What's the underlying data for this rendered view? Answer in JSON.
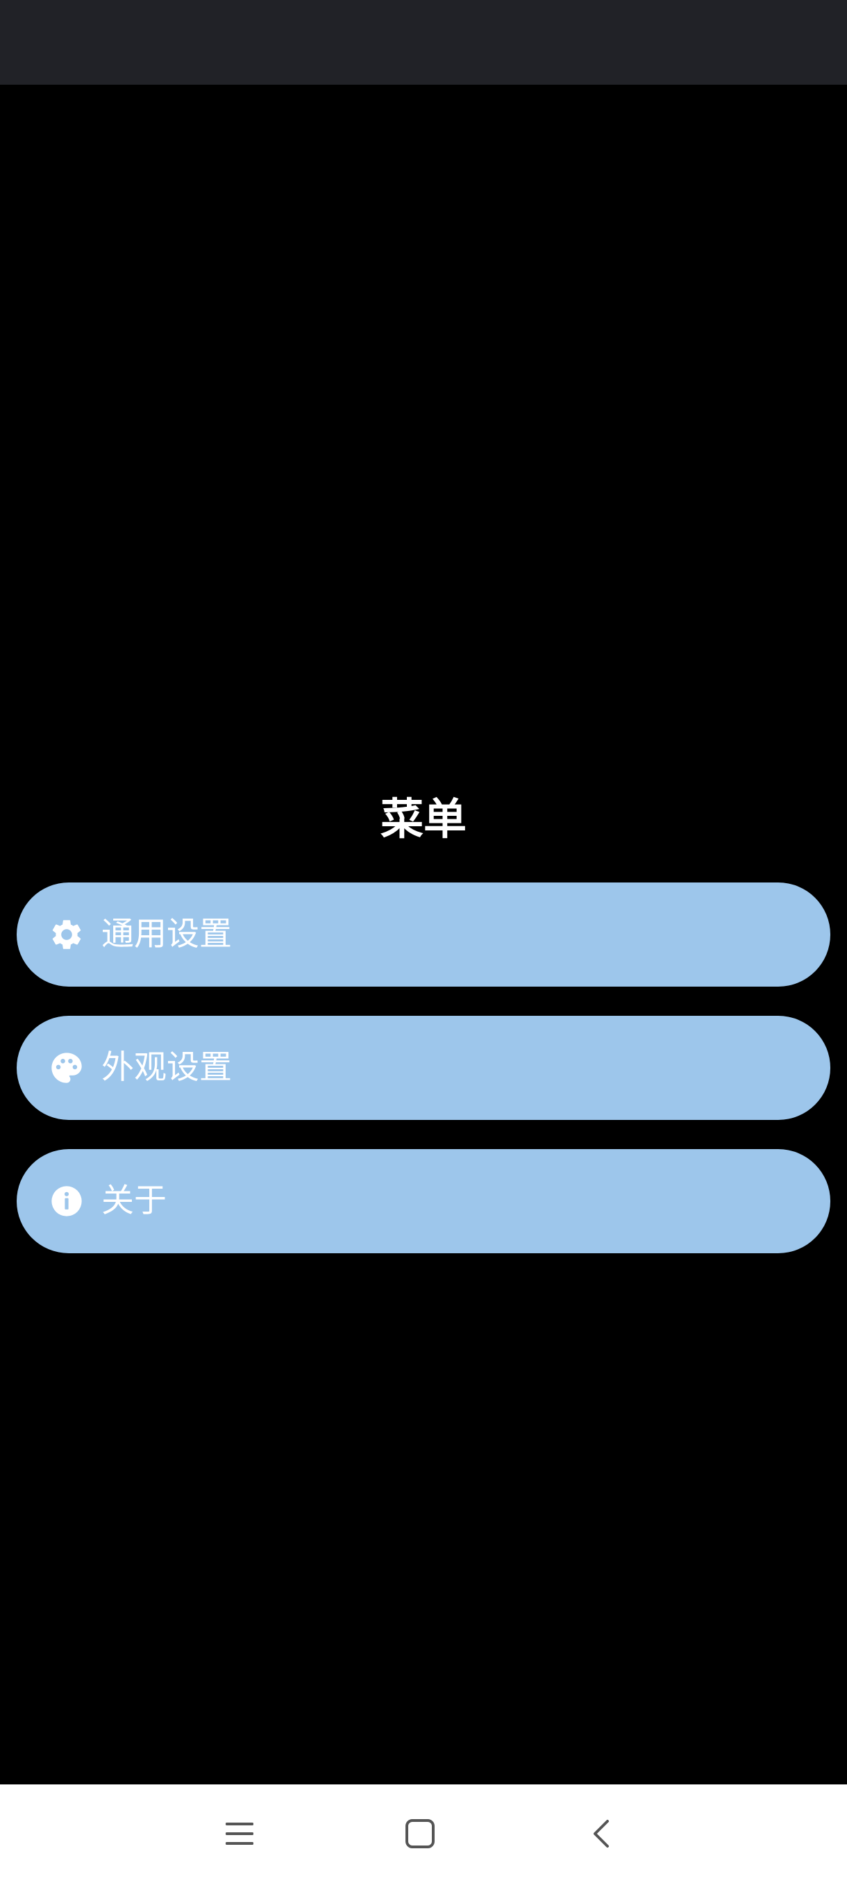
{
  "colors": {
    "status_bar": "#212227",
    "background": "#000000",
    "menu_item_bg": "#9dc6eb",
    "menu_text": "#ffffff",
    "nav_bar_bg": "#ffffff",
    "nav_icon": "#555555"
  },
  "menu": {
    "title": "菜单",
    "items": [
      {
        "icon": "gear-icon",
        "label": "通用设置"
      },
      {
        "icon": "palette-icon",
        "label": "外观设置"
      },
      {
        "icon": "info-icon",
        "label": "关于"
      }
    ]
  },
  "nav_bar": {
    "buttons": [
      {
        "icon": "menu-icon"
      },
      {
        "icon": "home-square-icon"
      },
      {
        "icon": "back-chevron-icon"
      }
    ]
  }
}
